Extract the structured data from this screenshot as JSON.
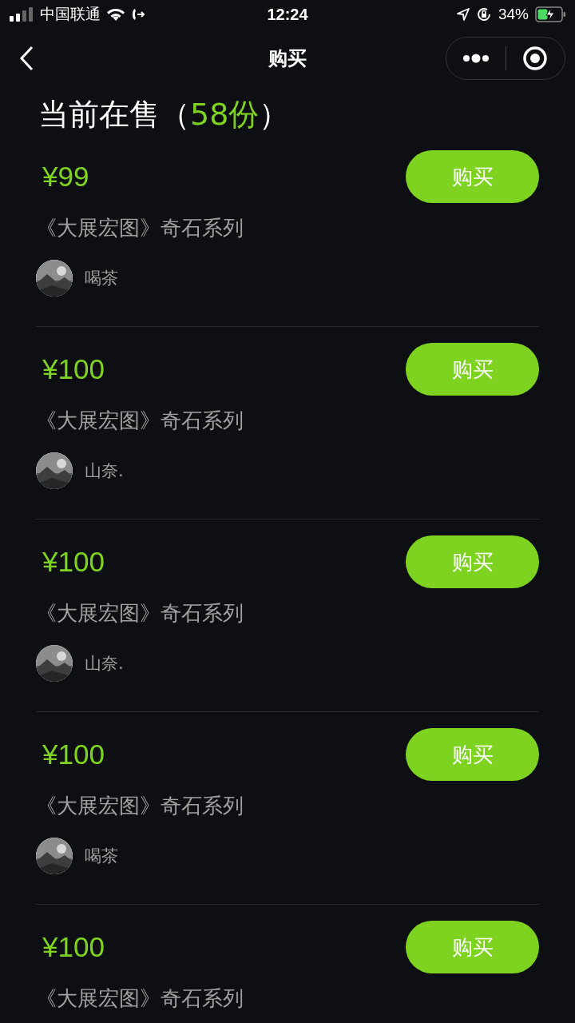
{
  "status_bar": {
    "carrier": "中国联通",
    "time": "12:24",
    "battery": "34%"
  },
  "nav": {
    "title": "购买"
  },
  "heading": {
    "text": "当前在售（",
    "count": "58份",
    "suffix": "）"
  },
  "listings": [
    {
      "price": "¥99",
      "name": "《大展宏图》奇石系列",
      "seller": "喝茶",
      "button": "购买"
    },
    {
      "price": "¥100",
      "name": "《大展宏图》奇石系列",
      "seller": "山奈.",
      "button": "购买"
    },
    {
      "price": "¥100",
      "name": "《大展宏图》奇石系列",
      "seller": "山奈.",
      "button": "购买"
    },
    {
      "price": "¥100",
      "name": "《大展宏图》奇石系列",
      "seller": "喝茶",
      "button": "购买"
    },
    {
      "price": "¥100",
      "name": "《大展宏图》奇石系列",
      "button": "购买"
    }
  ]
}
